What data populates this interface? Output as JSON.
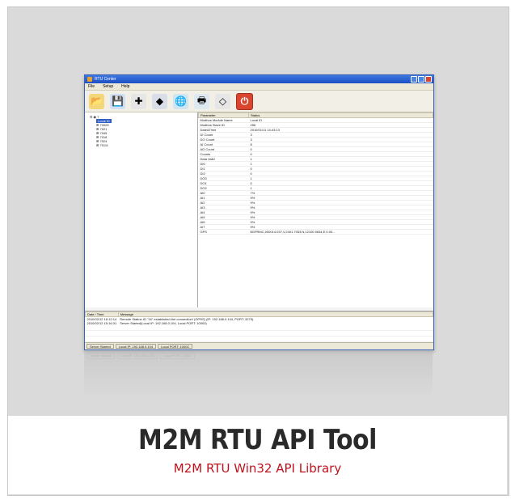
{
  "window": {
    "title": "RTU Center"
  },
  "menu": [
    "File",
    "Setup",
    "Help"
  ],
  "toolbar": {
    "buttons": [
      {
        "name": "open-folder-icon",
        "glyph": "📂",
        "bg": "#f3d77a"
      },
      {
        "name": "save-icon",
        "glyph": "💾",
        "bg": "#cfe0f4"
      },
      {
        "name": "add-icon",
        "glyph": "✚",
        "bg": "#e6e6e6"
      },
      {
        "name": "cube-icon",
        "glyph": "◆",
        "bg": "#d8dde8"
      },
      {
        "name": "globe-icon",
        "glyph": "🌐",
        "bg": "#cfe6f2"
      },
      {
        "name": "print-icon",
        "glyph": "🖶",
        "bg": "#dde8f0"
      },
      {
        "name": "eraser-icon",
        "glyph": "◇",
        "bg": "#e6e6e6"
      },
      {
        "name": "power-icon",
        "glyph": "⏻",
        "bg": "#d9452f"
      }
    ]
  },
  "tree": {
    "root": "7",
    "items": [
      "Local ID",
      "70005",
      "7021",
      "7045",
      "7018",
      "7024",
      "70111"
    ]
  },
  "grid": {
    "headers": [
      "Parameter",
      "Status"
    ],
    "rows": [
      [
        "Modbus Module Name",
        "Local ID"
      ],
      [
        "Modbus Slave ID",
        "256"
      ],
      [
        "Date&Time",
        "2010/01/11 14:43:13"
      ],
      [
        "DI Count",
        "3"
      ],
      [
        "DO Count",
        "3"
      ],
      [
        "AI Count",
        "8"
      ],
      [
        "AO Count",
        "0"
      ],
      [
        "Counts",
        "0"
      ],
      [
        "Data Valid",
        "1"
      ],
      [
        "DI0",
        "1"
      ],
      [
        "DI1",
        "0"
      ],
      [
        "DI2",
        "0"
      ],
      [
        "DO0",
        "1"
      ],
      [
        "DO1",
        "0"
      ],
      [
        "DO2",
        "1"
      ],
      [
        "AI0",
        "7%"
      ],
      [
        "AI1",
        "9%"
      ],
      [
        "AI2",
        "9%"
      ],
      [
        "AI3",
        "9%"
      ],
      [
        "AI4",
        "9%"
      ],
      [
        "AI5",
        "9%"
      ],
      [
        "AI6",
        "9%"
      ],
      [
        "AI7",
        "9%"
      ],
      [
        "GPS",
        "$GPRMC,000014.037,V,2401.7053,N,12100.9634,E,0.00..."
      ]
    ]
  },
  "log": {
    "headers": [
      "Date / Time",
      "Message"
    ],
    "rows": [
      [
        "2010/02/12  16:12:14",
        "Remote Station ID \"16\" established the connection! (GPRS) (IP: 192.168.0.104, PORT: 3275)"
      ],
      [
        "2010/02/12  15:16:31",
        "Server Started(Local IP: 192.168.0.104, Local PORT: 10000)"
      ]
    ]
  },
  "status": {
    "server": "Server Started",
    "local_ip": "Local IP: 192.168.0.104",
    "local_port": "Local PORT: 10000"
  },
  "caption": {
    "title": "M2M RTU API Tool",
    "subtitle": "M2M RTU Win32 API Library"
  }
}
